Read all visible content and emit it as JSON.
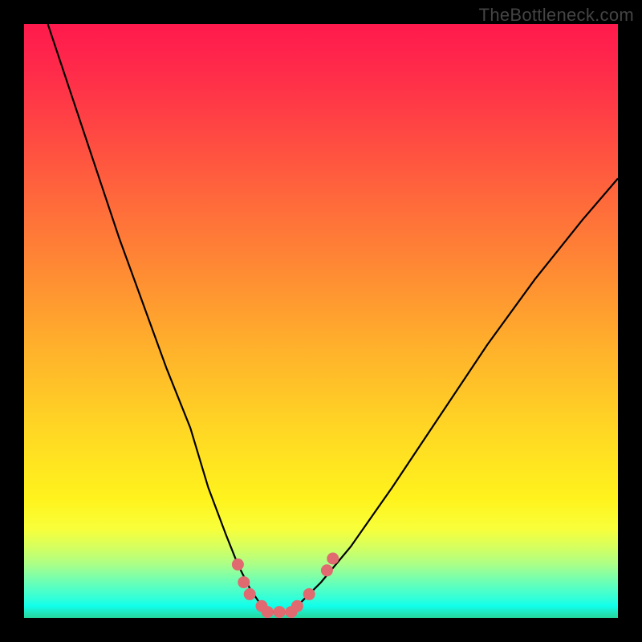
{
  "watermark": "TheBottleneck.com",
  "chart_data": {
    "type": "line",
    "title": "",
    "xlabel": "",
    "ylabel": "",
    "xlim": [
      0,
      100
    ],
    "ylim": [
      0,
      100
    ],
    "grid": false,
    "series": [
      {
        "name": "bottleneck-curve",
        "x": [
          4,
          8,
          12,
          16,
          20,
          24,
          28,
          31,
          34,
          36,
          38,
          40,
          42,
          44,
          46,
          50,
          55,
          62,
          70,
          78,
          86,
          94,
          100
        ],
        "y": [
          100,
          88,
          76,
          64,
          53,
          42,
          32,
          22,
          14,
          9,
          5,
          2,
          1,
          1,
          2,
          6,
          12,
          22,
          34,
          46,
          57,
          67,
          74
        ]
      }
    ],
    "markers": {
      "name": "highlight-dots",
      "color": "#e06a70",
      "points": [
        {
          "x": 36,
          "y": 9
        },
        {
          "x": 37,
          "y": 6
        },
        {
          "x": 38,
          "y": 4
        },
        {
          "x": 40,
          "y": 2
        },
        {
          "x": 41,
          "y": 1
        },
        {
          "x": 43,
          "y": 1
        },
        {
          "x": 45,
          "y": 1
        },
        {
          "x": 46,
          "y": 2
        },
        {
          "x": 48,
          "y": 4
        },
        {
          "x": 51,
          "y": 8
        },
        {
          "x": 52,
          "y": 10
        }
      ]
    },
    "colors": {
      "background_top": "#ff1a4d",
      "background_bottom": "#25d69c",
      "curve": "#000000",
      "frame": "#000000",
      "marker": "#e06a70"
    }
  }
}
